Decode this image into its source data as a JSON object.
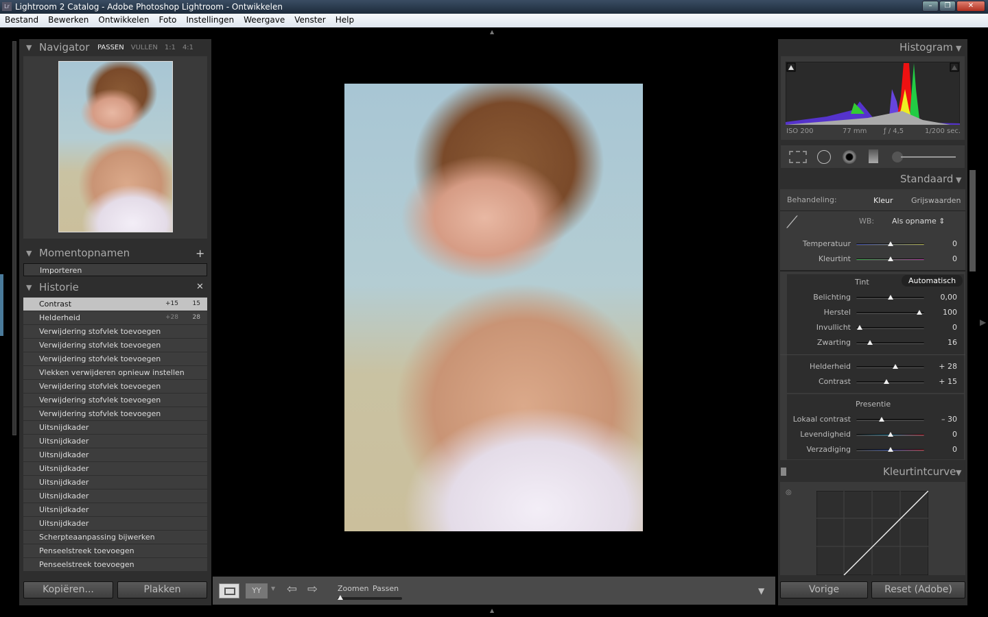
{
  "window": {
    "title": "Lightroom 2 Catalog - Adobe Photoshop Lightroom - Ontwikkelen",
    "app_icon": "Lr"
  },
  "menu": [
    "Bestand",
    "Bewerken",
    "Ontwikkelen",
    "Foto",
    "Instellingen",
    "Weergave",
    "Venster",
    "Help"
  ],
  "navigator": {
    "title": "Navigator",
    "modes": [
      "PASSEN",
      "VULLEN",
      "1:1",
      "4:1"
    ],
    "active": "PASSEN"
  },
  "snapshots": {
    "title": "Momentopnamen",
    "items": [
      "Importeren"
    ]
  },
  "history": {
    "title": "Historie",
    "items": [
      {
        "label": "Contrast",
        "from": "+15",
        "to": "15",
        "selected": true
      },
      {
        "label": "Helderheid",
        "from": "+28",
        "to": "28"
      },
      {
        "label": "Verwijdering stofvlek toevoegen"
      },
      {
        "label": "Verwijdering stofvlek toevoegen"
      },
      {
        "label": "Verwijdering stofvlek toevoegen"
      },
      {
        "label": "Vlekken verwijderen opnieuw instellen"
      },
      {
        "label": "Verwijdering stofvlek toevoegen"
      },
      {
        "label": "Verwijdering stofvlek toevoegen"
      },
      {
        "label": "Verwijdering stofvlek toevoegen"
      },
      {
        "label": "Uitsnijdkader"
      },
      {
        "label": "Uitsnijdkader"
      },
      {
        "label": "Uitsnijdkader"
      },
      {
        "label": "Uitsnijdkader"
      },
      {
        "label": "Uitsnijdkader"
      },
      {
        "label": "Uitsnijdkader"
      },
      {
        "label": "Uitsnijdkader"
      },
      {
        "label": "Uitsnijdkader"
      },
      {
        "label": "Scherpteaanpassing bijwerken"
      },
      {
        "label": "Penseelstreek toevoegen"
      },
      {
        "label": "Penseelstreek toevoegen"
      }
    ]
  },
  "left_buttons": {
    "copy": "Kopiëren...",
    "paste": "Plakken"
  },
  "toolbar": {
    "zoom_label": "Zoomen",
    "zoom_value": "Passen"
  },
  "histogram": {
    "title": "Histogram",
    "iso": "ISO 200",
    "focal": "77 mm",
    "aperture": "ƒ / 4,5",
    "shutter": "1/200 sec."
  },
  "basic": {
    "title": "Standaard",
    "treatment_label": "Behandeling:",
    "treatment_options": [
      "Kleur",
      "Grijswaarden"
    ],
    "wb_label": "WB:",
    "wb_value": "Als opname ⇕",
    "tone_label": "Tint",
    "auto_label": "Automatisch",
    "presence_label": "Presentie",
    "sliders": [
      {
        "label": "Temperatuur",
        "value": "0",
        "pos": 0.5,
        "group": "wb"
      },
      {
        "label": "Kleurtint",
        "value": "0",
        "pos": 0.5,
        "group": "wb"
      },
      {
        "label": "Belichting",
        "value": "0,00",
        "pos": 0.5,
        "group": "tone"
      },
      {
        "label": "Herstel",
        "value": "100",
        "pos": 0.93,
        "group": "tone"
      },
      {
        "label": "Invullicht",
        "value": "0",
        "pos": 0.05,
        "group": "tone"
      },
      {
        "label": "Zwarting",
        "value": "16",
        "pos": 0.2,
        "group": "tone"
      },
      {
        "label": "Helderheid",
        "value": "+ 28",
        "pos": 0.58,
        "group": "tone2"
      },
      {
        "label": "Contrast",
        "value": "+ 15",
        "pos": 0.44,
        "group": "tone2"
      },
      {
        "label": "Lokaal contrast",
        "value": "– 30",
        "pos": 0.37,
        "group": "presence"
      },
      {
        "label": "Levendigheid",
        "value": "0",
        "pos": 0.5,
        "group": "presence"
      },
      {
        "label": "Verzadiging",
        "value": "0",
        "pos": 0.5,
        "group": "presence"
      }
    ]
  },
  "tone_curve": {
    "title": "Kleurtintcurve"
  },
  "right_buttons": {
    "previous": "Vorige",
    "reset": "Reset (Adobe)"
  }
}
